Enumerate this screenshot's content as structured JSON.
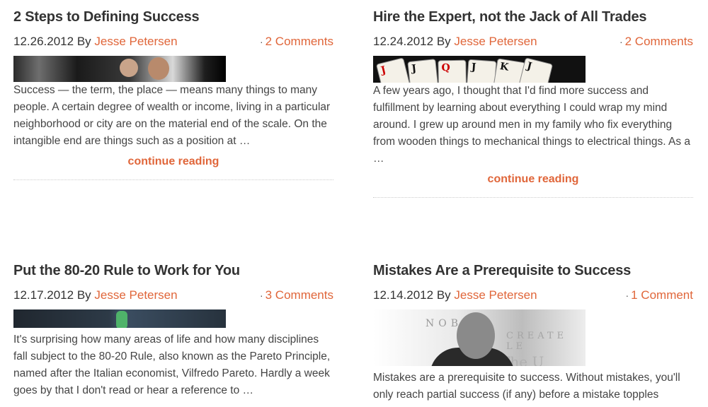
{
  "posts": [
    {
      "title": "2 Steps to Defining Success",
      "date": "12.26.2012",
      "by": "By",
      "author": "Jesse Petersen",
      "comments": "2 Comments",
      "excerpt": "Success — the term, the place — means many things to many people. A certain degree of wealth or income, living in a particular neighborhood or city are on the material end of the scale. On the intangible end are things such as a position at …",
      "more": "continue reading"
    },
    {
      "title": "Hire the Expert, not the Jack of All Trades",
      "date": "12.24.2012",
      "by": "By",
      "author": "Jesse Petersen",
      "comments": "2 Comments",
      "excerpt": "A few years ago, I thought that I'd find more success and fulfillment by learning about everything I could wrap my mind around. I grew up around men in my family who fix everything from wooden things to mechanical things to electrical things. As a …",
      "more": "continue reading"
    },
    {
      "title": "Put the 80-20 Rule to Work for You",
      "date": "12.17.2012",
      "by": "By",
      "author": "Jesse Petersen",
      "comments": "3 Comments",
      "excerpt": "It's surprising how many areas of life and how many disciplines fall subject to the 80-20 Rule, also known as the Pareto Principle, named after the Italian economist, Vilfredo Pareto. Hardly a week goes by that I don't read or hear a reference to …"
    },
    {
      "title": "Mistakes Are a Prerequisite to Success",
      "date": "12.14.2012",
      "by": "By",
      "author": "Jesse Petersen",
      "comments": "1 Comment",
      "excerpt": "Mistakes are a prerequisite to success. Without mistakes, you'll only reach partial success (if any) before a mistake topples",
      "thumb_text": [
        "NOBE",
        "CREATE LE",
        "The U"
      ]
    }
  ],
  "card_ranks": [
    "J",
    "J",
    "Q",
    "J",
    "K",
    "J"
  ],
  "colors": {
    "accent": "#e0663a"
  }
}
